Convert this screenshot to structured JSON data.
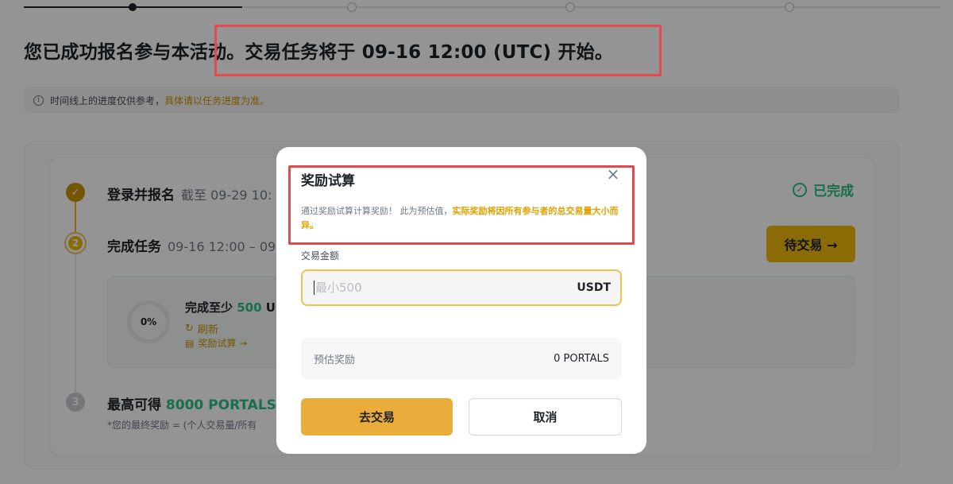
{
  "timeline": {
    "progress_label": ""
  },
  "headline": {
    "text": "您已成功报名参与本活动。交易任务将于 09-16 12:00 (UTC) 开始。"
  },
  "notice": {
    "text": "时间线上的进度仅供参考，",
    "link_text": "具体请以任务进度为准。"
  },
  "steps": [
    {
      "number": "1",
      "title": "登录并报名",
      "subtitle": "截至 09-29 10:",
      "status": "已完成"
    },
    {
      "number": "2",
      "title": "完成任务",
      "subtitle": "09-16 12:00 – 09",
      "action": "待交易 →"
    },
    {
      "number": "3",
      "title": "最高可得",
      "reward": "8000 PORTALS"
    }
  ],
  "task": {
    "progress": "0%",
    "title_prefix": "完成至少",
    "title_amount": "500",
    "title_suffix": "U",
    "refresh_label": "刷新",
    "calc_label": "奖励试算 →"
  },
  "formula": "*您的最终奖励 = (个人交易量/所有",
  "modal": {
    "title": "奖励试算",
    "desc_normal": "通过奖励试算计算奖励！ 此为预估值，",
    "desc_highlight": "实际奖励将因所有参与者的总交易量大小而异。",
    "amount_label": "交易金额",
    "amount_placeholder": "最小500",
    "amount_unit": "USDT",
    "estimate_label": "预估奖励",
    "estimate_value": "0 PORTALS",
    "trade_button": "去交易",
    "cancel_button": "取消"
  },
  "colors": {
    "brand_yellow": "#f0b90b",
    "success_green": "#2ebd85",
    "annotation_red": "#e5484d"
  }
}
